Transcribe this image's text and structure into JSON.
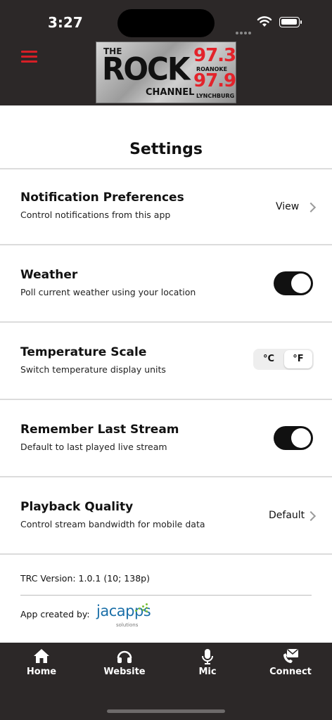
{
  "status_bar": {
    "time": "3:27"
  },
  "header": {
    "logo": {
      "the": "THE",
      "rock": "ROCK",
      "channel": "CHANNEL",
      "freq1": "97.3",
      "city1": "ROANOKE",
      "freq2": "97.9",
      "city2": "LYNCHBURG"
    },
    "accent_color": "#d61f26",
    "background_color": "#2c2828"
  },
  "page": {
    "title": "Settings"
  },
  "settings": {
    "notifications": {
      "title": "Notification Preferences",
      "subtitle": "Control notifications from this app",
      "value": "View"
    },
    "weather": {
      "title": "Weather",
      "subtitle": "Poll current weather using your location",
      "enabled": true
    },
    "temperature": {
      "title": "Temperature Scale",
      "subtitle": "Switch temperature display units",
      "option_c": "°C",
      "option_f": "°F",
      "selected": "°F"
    },
    "remember_stream": {
      "title": "Remember Last Stream",
      "subtitle": "Default to last played live stream",
      "enabled": true
    },
    "playback": {
      "title": "Playback Quality",
      "subtitle": "Control stream bandwidth for mobile data",
      "value": "Default"
    }
  },
  "footer": {
    "version": "TRC Version: 1.0.1 (10; 138p)",
    "credit_label": "App created by:",
    "brand_name": "jacapps",
    "brand_sub": "solutions"
  },
  "tabs": [
    {
      "label": "Home",
      "icon": "home-icon"
    },
    {
      "label": "Website",
      "icon": "headphones-icon"
    },
    {
      "label": "Mic",
      "icon": "microphone-icon"
    },
    {
      "label": "Connect",
      "icon": "envelope-phone-icon"
    }
  ]
}
